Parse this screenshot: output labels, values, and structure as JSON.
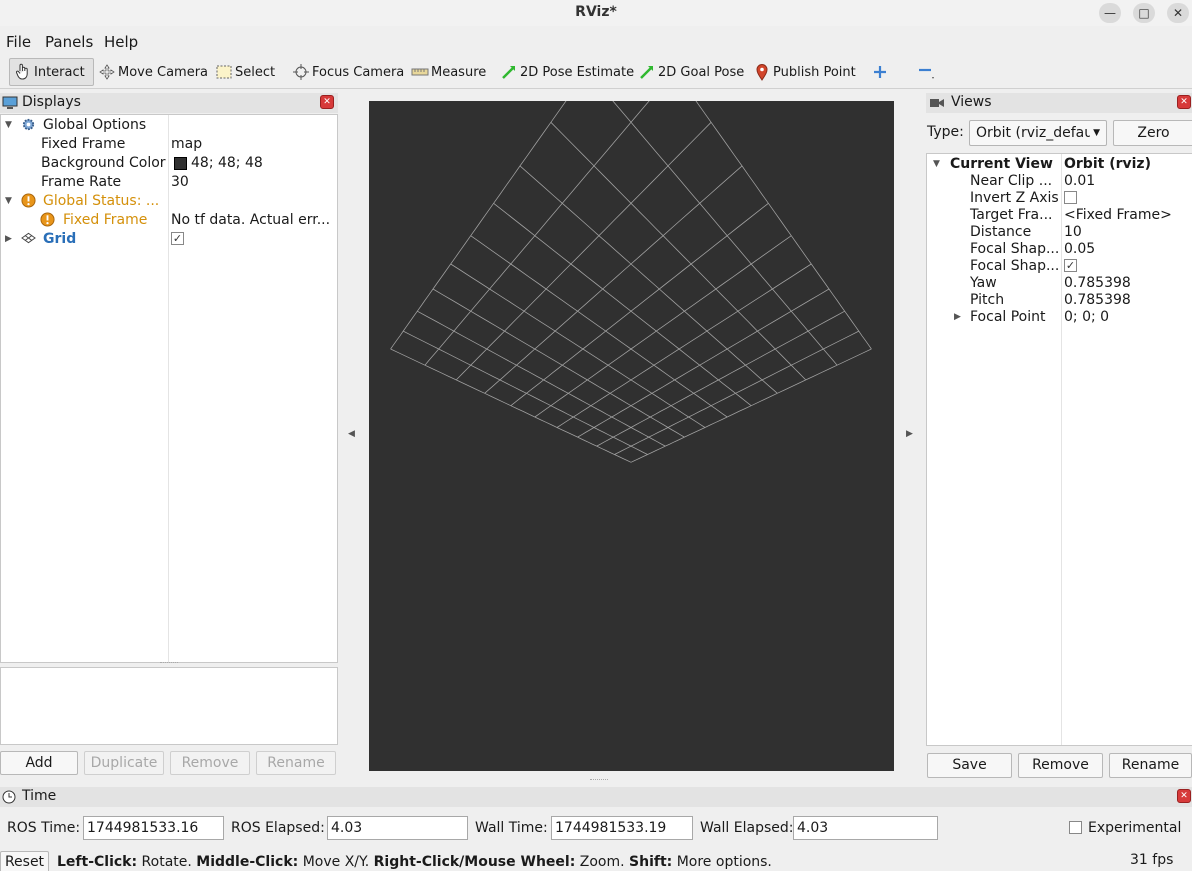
{
  "window": {
    "title": "RViz*"
  },
  "menu": {
    "file": "File",
    "panels": "Panels",
    "help": "Help"
  },
  "toolbar": {
    "interact": "Interact",
    "move_camera": "Move Camera",
    "select": "Select",
    "focus_camera": "Focus Camera",
    "measure": "Measure",
    "pose_estimate": "2D Pose Estimate",
    "goal_pose": "2D Goal Pose",
    "publish_point": "Publish Point"
  },
  "displays": {
    "title": "Displays",
    "global_options": "Global Options",
    "fixed_frame_label": "Fixed Frame",
    "fixed_frame_value": "map",
    "bg_color_label": "Background Color",
    "bg_color_value": "48; 48; 48",
    "frame_rate_label": "Frame Rate",
    "frame_rate_value": "30",
    "global_status": "Global Status: ...",
    "status_fixed_frame": "Fixed Frame",
    "status_message": "No tf data.  Actual err...",
    "grid": "Grid",
    "buttons": {
      "add": "Add",
      "duplicate": "Duplicate",
      "remove": "Remove",
      "rename": "Rename"
    }
  },
  "views": {
    "title": "Views",
    "type_label": "Type:",
    "type_value": "Orbit (rviz_defau",
    "zero": "Zero",
    "current_view": "Current View",
    "current_view_value": "Orbit (rviz)",
    "props": [
      {
        "label": "Near Clip ...",
        "value": "0.01"
      },
      {
        "label": "Invert Z Axis",
        "value": ""
      },
      {
        "label": "Target Fra...",
        "value": "<Fixed Frame>"
      },
      {
        "label": "Distance",
        "value": "10"
      },
      {
        "label": "Focal Shap...",
        "value": "0.05"
      },
      {
        "label": "Focal Shap...",
        "value": ""
      },
      {
        "label": "Yaw",
        "value": "0.785398"
      },
      {
        "label": "Pitch",
        "value": "0.785398"
      },
      {
        "label": "Focal Point",
        "value": "0; 0; 0"
      }
    ],
    "buttons": {
      "save": "Save",
      "remove": "Remove",
      "rename": "Rename"
    }
  },
  "time": {
    "title": "Time",
    "ros_time_label": "ROS Time:",
    "ros_time_value": "1744981533.16",
    "ros_elapsed_label": "ROS Elapsed:",
    "ros_elapsed_value": "4.03",
    "wall_time_label": "Wall Time:",
    "wall_time_value": "1744981533.19",
    "wall_elapsed_label": "Wall Elapsed:",
    "wall_elapsed_value": "4.03",
    "experimental": "Experimental"
  },
  "status": {
    "reset": "Reset",
    "left_click": "Left-Click:",
    "left_desc": " Rotate. ",
    "middle_click": "Middle-Click:",
    "middle_desc": " Move X/Y. ",
    "right_click": "Right-Click/Mouse Wheel:",
    "right_desc": " Zoom. ",
    "shift": "Shift:",
    "shift_desc": " More options.",
    "fps": "31 fps"
  },
  "colors": {
    "background": "#303030",
    "grid": "#a0a0a0",
    "warning": "#d4900a",
    "link_blue": "#2a6fb8",
    "close_red": "#d73a3a"
  }
}
